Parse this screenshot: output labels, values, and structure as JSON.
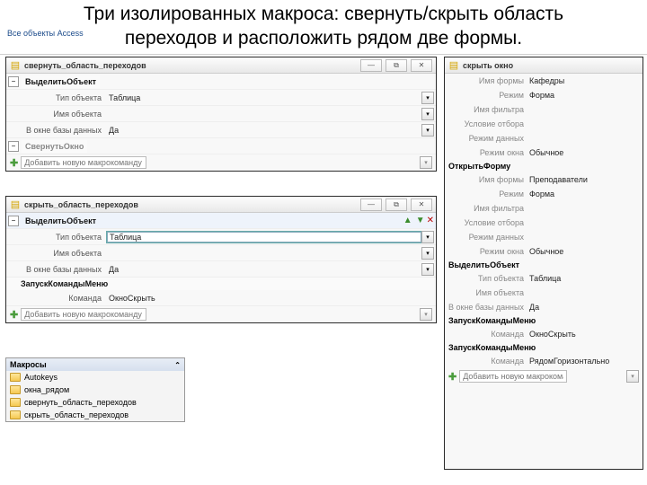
{
  "title_line1": "Три изолированных макроса: свернуть/скрыть область",
  "title_line2": "переходов и расположить рядом две формы.",
  "nav_label": "Все объекты Access",
  "p1": {
    "title": "свернуть_область_переходов",
    "sect": "ВыделитьОбъект",
    "r1_lbl": "Тип объекта",
    "r1_val": "Таблица",
    "r2_lbl": "Имя объекта",
    "r2_val": "",
    "r3_lbl": "В окне базы данных",
    "r3_val": "Да",
    "sect2": "СвернутьОкно",
    "add": "Добавить новую макрокоманду"
  },
  "p2": {
    "title": "скрыть_область_переходов",
    "sect": "ВыделитьОбъект",
    "r1_lbl": "Тип объекта",
    "r1_val": "Таблица",
    "r2_lbl": "Имя объекта",
    "r2_val": "",
    "r3_lbl": "В окне базы данных",
    "r3_val": "Да",
    "sect2": "ЗапускКомандыМеню",
    "r4_lbl": "Команда",
    "r4_val": "ОкноСкрыть",
    "add": "Добавить новую макрокоманду"
  },
  "p3": {
    "title": "скрыть окно",
    "rows": [
      {
        "lbl": "Имя формы",
        "val": "Кафедры"
      },
      {
        "lbl": "Режим",
        "val": "Форма"
      },
      {
        "lbl": "Имя фильтра",
        "val": ""
      },
      {
        "lbl": "Условие отбора",
        "val": ""
      },
      {
        "lbl": "Режим данных",
        "val": ""
      },
      {
        "lbl": "Режим окна",
        "val": "Обычное"
      }
    ],
    "sect2": "ОткрытьФорму",
    "rows2": [
      {
        "lbl": "Имя формы",
        "val": "Преподаватели"
      },
      {
        "lbl": "Режим",
        "val": "Форма"
      },
      {
        "lbl": "Имя фильтра",
        "val": ""
      },
      {
        "lbl": "Условие отбора",
        "val": ""
      },
      {
        "lbl": "Режим данных",
        "val": ""
      },
      {
        "lbl": "Режим окна",
        "val": "Обычное"
      }
    ],
    "sect3": "ВыделитьОбъект",
    "rows3": [
      {
        "lbl": "Тип объекта",
        "val": "Таблица"
      },
      {
        "lbl": "Имя объекта",
        "val": ""
      },
      {
        "lbl": "В окне базы данных",
        "val": "Да"
      }
    ],
    "sect4": "ЗапускКомандыМеню",
    "r4_lbl": "Команда",
    "r4_val": "ОкноСкрыть",
    "sect5": "ЗапускКомандыМеню",
    "r5_lbl": "Команда",
    "r5_val": "РядомГоризонтально",
    "add": "Добавить новую макрокоманду"
  },
  "nav": {
    "hdr": "Макросы",
    "items": [
      "Autokeys",
      "окна_рядом",
      "свернуть_область_переходов",
      "скрыть_область_переходов"
    ]
  }
}
